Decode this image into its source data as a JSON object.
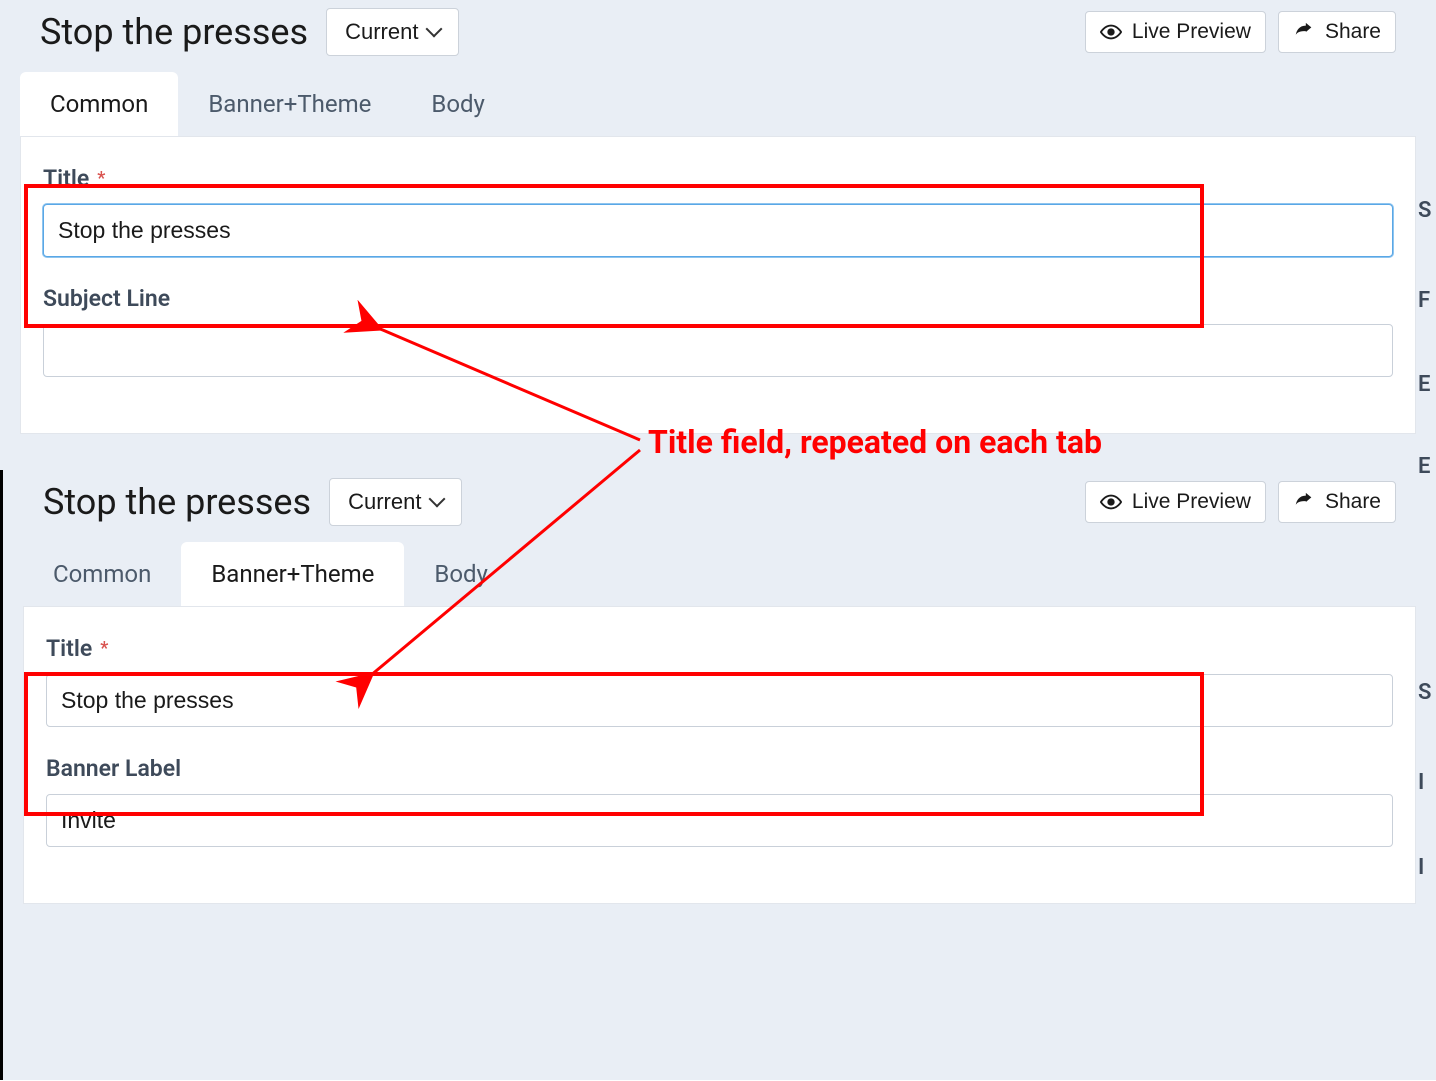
{
  "panes": {
    "top": {
      "title": "Stop the presses",
      "version_btn": "Current",
      "live_preview": "Live Preview",
      "share": "Share",
      "tabs": [
        "Common",
        "Banner+Theme",
        "Body"
      ],
      "active_tab": 0,
      "fields": {
        "title_label": "Title",
        "title_value": "Stop the presses",
        "subject_label": "Subject Line",
        "subject_value": ""
      }
    },
    "bottom": {
      "title": "Stop the presses",
      "version_btn": "Current",
      "live_preview": "Live Preview",
      "share": "Share",
      "tabs": [
        "Common",
        "Banner+Theme",
        "Body"
      ],
      "active_tab": 1,
      "fields": {
        "title_label": "Title",
        "title_value": "Stop the presses",
        "banner_label": "Banner Label",
        "banner_value": "Invite"
      }
    }
  },
  "annotation": {
    "text": "Title field, repeated on each tab"
  },
  "side_stubs_top": [
    "S",
    "F",
    "E",
    "E"
  ],
  "side_stubs_bottom": [
    "S",
    "I",
    "I"
  ],
  "colors": {
    "page_bg": "#e9eef5",
    "highlight": "#ff0000",
    "focus_border": "#5aa7e6",
    "text_muted": "#4c5a6b",
    "required": "#d9534f"
  }
}
